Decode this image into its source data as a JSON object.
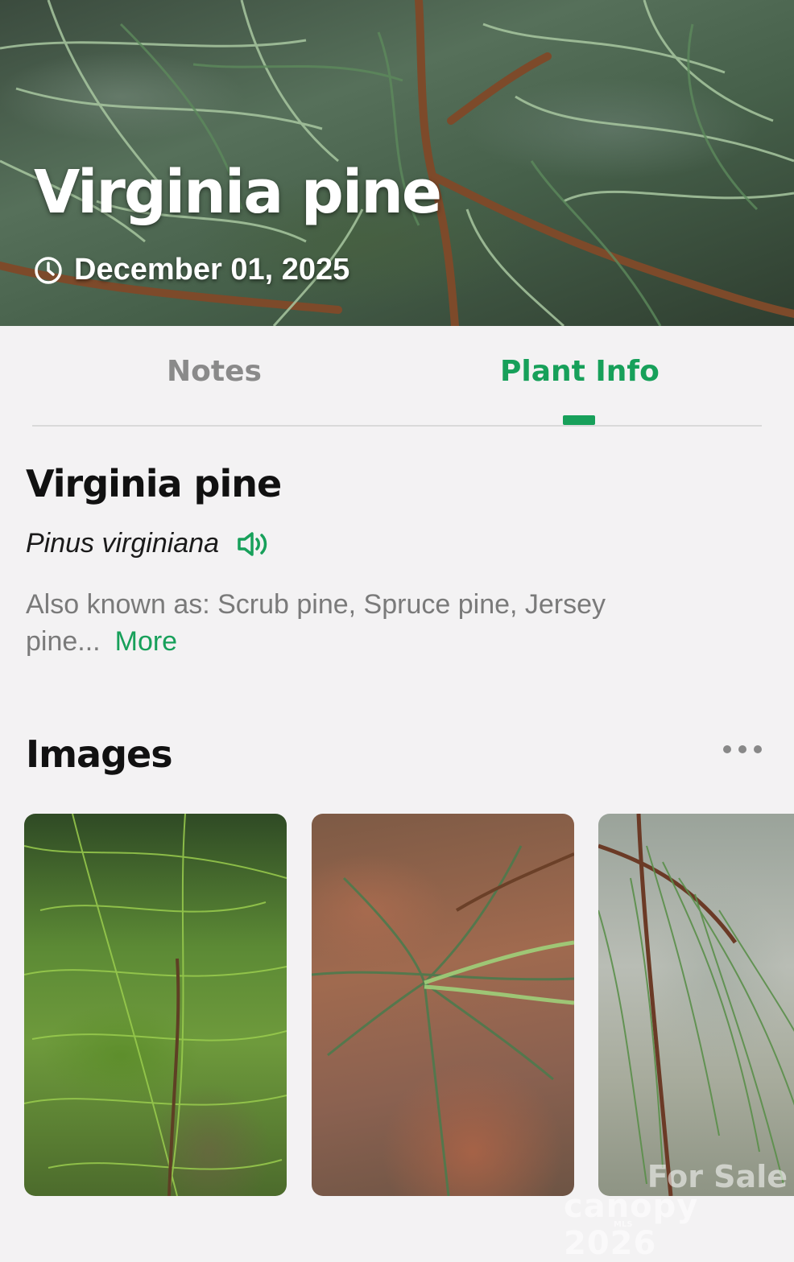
{
  "header": {
    "title": "Virginia pine",
    "date": "December 01, 2025",
    "date_icon": "clock-icon"
  },
  "tabs": [
    {
      "label": "Notes",
      "active": false
    },
    {
      "label": "Plant Info",
      "active": true
    }
  ],
  "plant": {
    "common_name": "Virginia pine",
    "scientific_name": "Pinus virginiana",
    "audio_icon": "speaker-icon",
    "also_known_as": "Also known as: Scrub pine, Spruce pine, Jersey pine...",
    "more_label": "More"
  },
  "images_section": {
    "title": "Images",
    "menu_icon": "more-dots-icon",
    "thumbnails": [
      {
        "description_icon": "pine-photo-1"
      },
      {
        "description_icon": "pine-photo-2"
      },
      {
        "description_icon": "pine-photo-3"
      }
    ]
  },
  "watermark": {
    "top": "For Sale",
    "brand": "canopy 2026",
    "sub": "MLS"
  },
  "colors": {
    "accent": "#17a05a",
    "background": "#f3f2f3",
    "inactive_tab": "#8a8a8a",
    "body_text": "#111111",
    "secondary_text": "#7a7a7a"
  }
}
